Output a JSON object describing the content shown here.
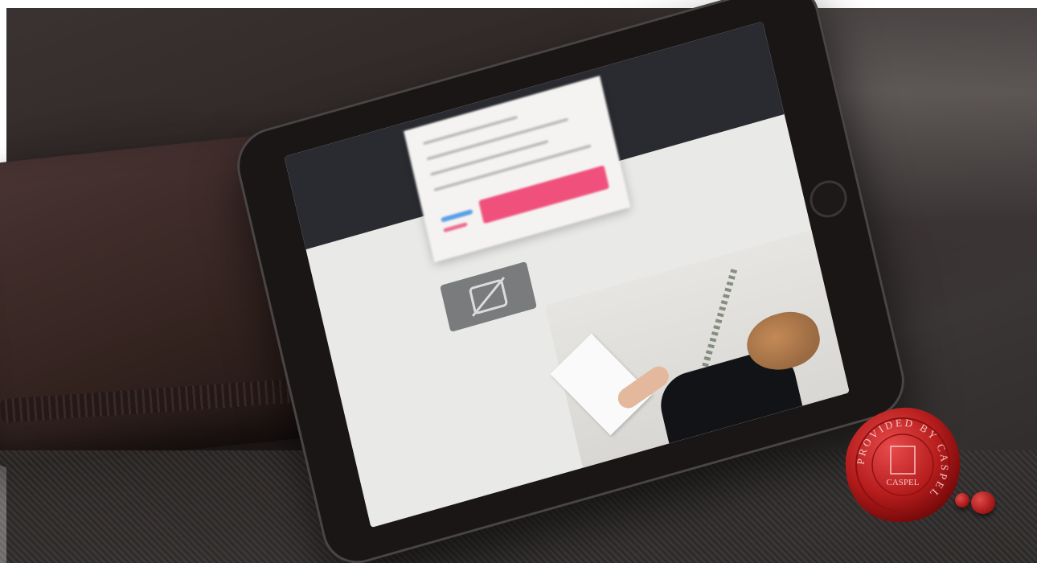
{
  "scene": {
    "subject": "tablet",
    "seal": {
      "ring_text": "PROVIDED BY CASPEL",
      "center_text": "CASPEL",
      "color": "#b51c1c"
    },
    "screen": {
      "accent_button_color": "#f0517c",
      "accent_link_color": "#5a9ee8",
      "header_color": "#2a2b31"
    }
  }
}
